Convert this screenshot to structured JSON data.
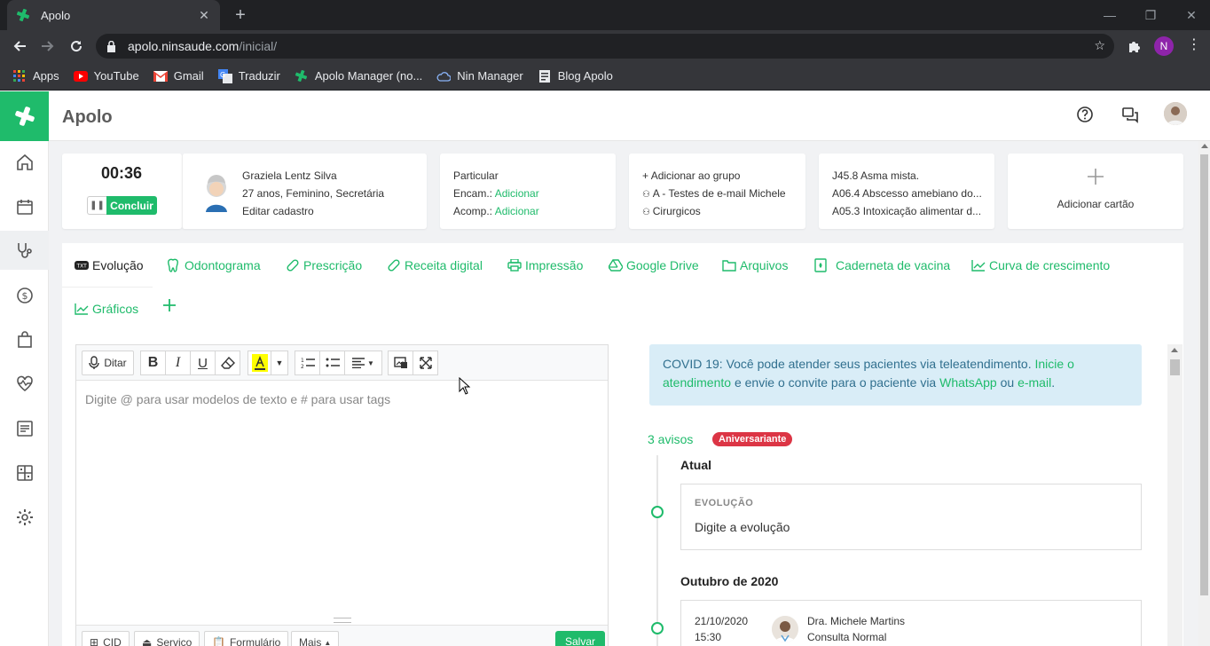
{
  "browser": {
    "tab_title": "Apolo",
    "url_host": "apolo.ninsaude.com",
    "url_path": "/inicial/",
    "profile_initial": "N",
    "bookmarks": [
      "Apps",
      "YouTube",
      "Gmail",
      "Traduzir",
      "Apolo Manager (no...",
      "Nin Manager",
      "Blog Apolo"
    ]
  },
  "app": {
    "title": "Apolo",
    "brand_color": "#1fbb6b"
  },
  "sidebar": {
    "items": [
      "home-icon",
      "calendar-icon",
      "stethoscope-icon",
      "dollar-icon",
      "bag-icon",
      "heart-pulse-icon",
      "report-icon",
      "dashboard-icon",
      "gear-icon"
    ]
  },
  "session": {
    "timer": "00:36",
    "conclude_label": "Concluir"
  },
  "patient": {
    "name": "Graziela Lentz Silva",
    "details": "27 anos, Feminino, Secretária",
    "edit_label": "Editar cadastro"
  },
  "insurance": {
    "plan": "Particular",
    "encam_label": "Encam.:",
    "encam_action": "Adicionar",
    "acomp_label": "Acomp.:",
    "acomp_action": "Adicionar"
  },
  "groups": {
    "add_label": "Adicionar ao grupo",
    "items": [
      "A - Testes de e-mail Michele",
      "Cirurgicos"
    ]
  },
  "diagnoses": {
    "items": [
      "J45.8 Asma mista.",
      "A06.4 Abscesso amebiano do...",
      "A05.3 Intoxicação alimentar d..."
    ]
  },
  "add_card": {
    "label": "Adicionar cartão"
  },
  "tabs": [
    {
      "label": "Evolução"
    },
    {
      "label": "Odontograma"
    },
    {
      "label": "Prescrição"
    },
    {
      "label": "Receita digital"
    },
    {
      "label": "Impressão"
    },
    {
      "label": "Google Drive"
    },
    {
      "label": "Arquivos"
    },
    {
      "label": "Caderneta de vacina"
    },
    {
      "label": "Curva de crescimento"
    },
    {
      "label": "Gráficos"
    }
  ],
  "editor": {
    "dictate_label": "Ditar",
    "placeholder": "Digite @ para usar modelos de texto e # para usar tags",
    "footer": {
      "cid": "CID",
      "servico": "Serviço",
      "formulario": "Formulário",
      "mais": "Mais",
      "save": "Salvar"
    }
  },
  "notice": {
    "text1": "COVID 19: Você pode atender seus pacientes via teleatendimento.",
    "link1": "Inicie o atendimento",
    "text2": "e envie o convite para o paciente via",
    "link2": "WhatsApp",
    "text3": "ou",
    "link3": "e-mail",
    "text4": "."
  },
  "timeline": {
    "alerts": "3 avisos",
    "birthday_badge": "Aniversariante",
    "current_heading": "Atual",
    "current_card_label": "EVOLUÇÃO",
    "current_card_text": "Digite a evolução",
    "month_heading": "Outubro de 2020",
    "entry_date": "21/10/2020",
    "entry_time": "15:30",
    "entry_doctor": "Dra. Michele Martins",
    "entry_type": "Consulta Normal"
  }
}
